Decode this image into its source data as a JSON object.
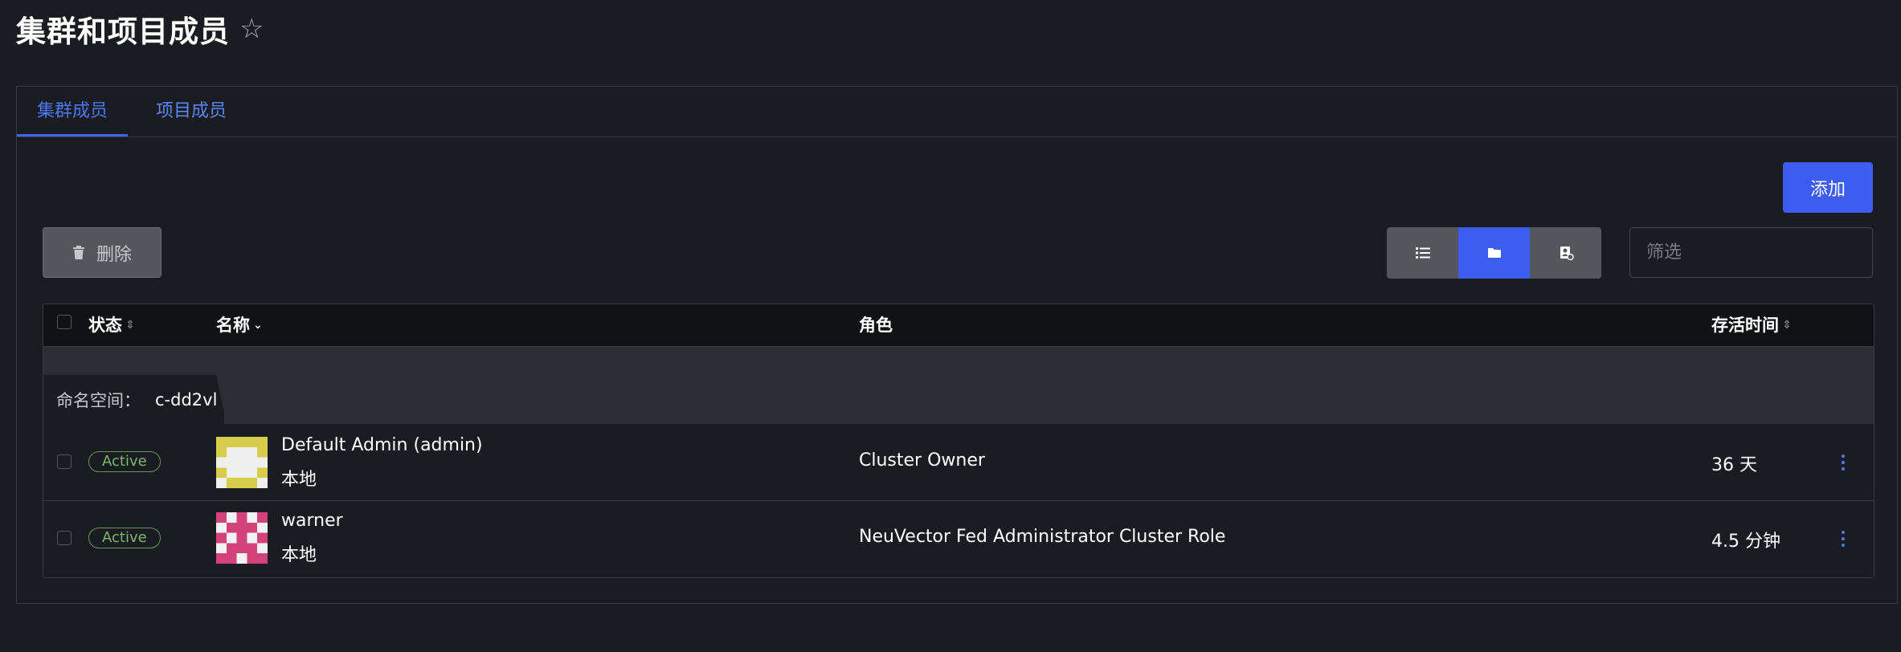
{
  "page": {
    "title": "集群和项目成员"
  },
  "tabs": [
    {
      "label": "集群成员",
      "active": true
    },
    {
      "label": "项目成员",
      "active": false
    }
  ],
  "toolbar": {
    "add_label": "添加",
    "delete_label": "删除",
    "filter_placeholder": "筛选",
    "view_modes": [
      "list-icon",
      "folder-icon",
      "user-lock-icon"
    ],
    "active_view": "folder-icon"
  },
  "table": {
    "headers": {
      "state": "状态",
      "name": "名称",
      "role": "角色",
      "age": "存活时间"
    },
    "group": {
      "label": "命名空间：",
      "value": "c-dd2vl"
    },
    "rows": [
      {
        "state": "Active",
        "name": "Default Admin (admin)",
        "provider": "本地",
        "role": "Cluster Owner",
        "age": "36 天"
      },
      {
        "state": "Active",
        "name": "warner",
        "provider": "本地",
        "role": "NeuVector Fed Administrator Cluster Role",
        "age": "4.5 分钟"
      }
    ]
  },
  "colors": {
    "accent": "#3d5df0",
    "active_badge": "#79b86d",
    "background": "#1b1c21"
  }
}
